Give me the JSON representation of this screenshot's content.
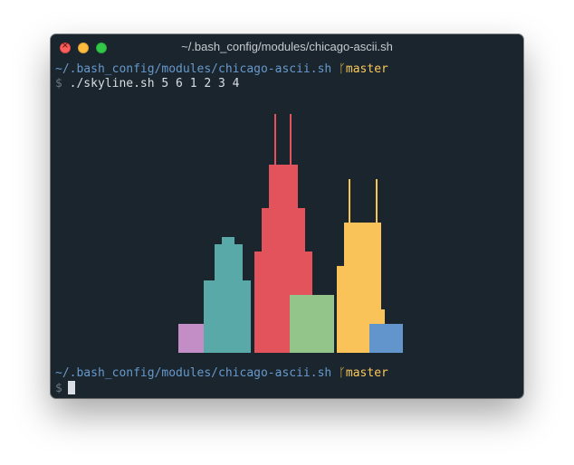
{
  "window": {
    "title": "~/.bash_config/modules/chicago-ascii.sh"
  },
  "terminal": {
    "prompt1": {
      "path": "~/.bash_config/modules/chicago-ascii.sh",
      "branch_symbol": "ᚴ",
      "branch": "master"
    },
    "command_line": {
      "symbol": "$",
      "command": "./skyline.sh 5 6 1 2 3 4"
    },
    "prompt2": {
      "path": "~/.bash_config/modules/chicago-ascii.sh",
      "branch_symbol": "ᚴ",
      "branch": "master"
    },
    "input_line": {
      "symbol": "$",
      "value": ""
    }
  },
  "colors": {
    "background": "#1b252d",
    "path": "#6699cc",
    "branch": "#f9c85b",
    "building_purple": "#c38dc5",
    "building_teal": "#5aa9a9",
    "building_red": "#e3535c",
    "building_green": "#93c48a",
    "building_yellow": "#f9c35a",
    "building_blue": "#6195cc"
  },
  "icons": {
    "close": "close-icon",
    "minimize": "minimize-icon",
    "zoom": "zoom-icon"
  }
}
